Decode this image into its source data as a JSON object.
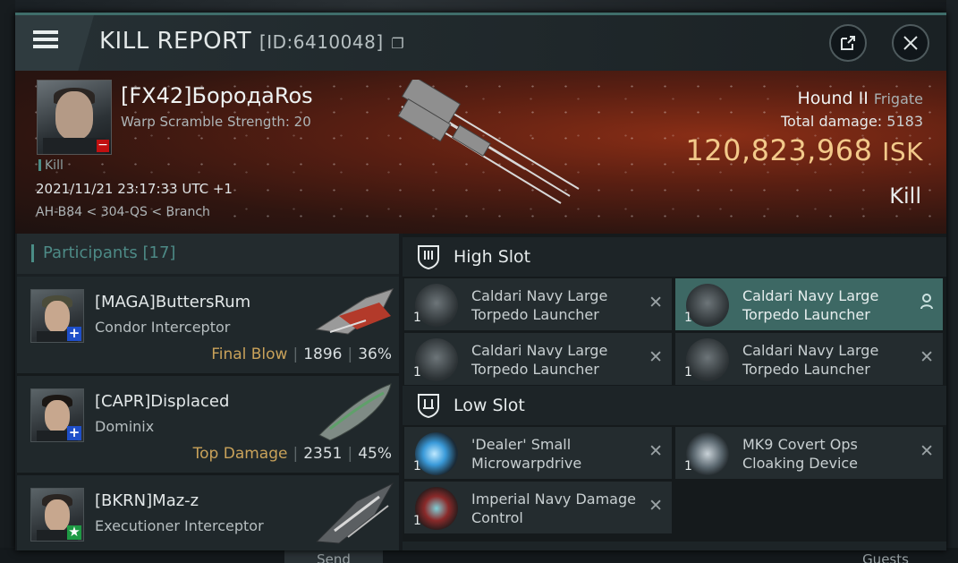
{
  "background": {
    "send_label": "Send",
    "guests_label": "Guests"
  },
  "window": {
    "title": "KILL REPORT",
    "id_label": "[ID:6410048]",
    "accent": "#3f6d6a"
  },
  "victim": {
    "name": "[FX42]БородаRos",
    "warp_scramble": "Warp Scramble Strength: 20",
    "kill_tag": "Kill",
    "datetime": "2021/11/21 23:17:33 UTC +1",
    "location": "AH-B84 < 304-QS < Branch",
    "ship_name": "Hound II",
    "ship_class": "Frigate",
    "total_damage_label": "Total damage:",
    "total_damage": "5183",
    "isk_value": "120,823,968",
    "isk_unit": "ISK",
    "result": "Kill"
  },
  "participants": {
    "label": "Participants",
    "count": "[17]",
    "rows": [
      {
        "name": "[MAGA]ButtersRum",
        "ship": "Condor Interceptor",
        "tag": "Final Blow",
        "damage": "1896",
        "percent": "36%",
        "badge_color": "#1f4fc9"
      },
      {
        "name": "[CAPR]Displaced",
        "ship": "Dominix",
        "tag": "Top Damage",
        "damage": "2351",
        "percent": "45%",
        "badge_color": "#1f4fc9"
      },
      {
        "name": "[BKRN]Maz-z",
        "ship": "Executioner Interceptor",
        "tag": "",
        "damage": "",
        "percent": "",
        "badge_color": "#1e9a44"
      }
    ]
  },
  "slots": {
    "high_label": "High Slot",
    "low_label": "Low Slot",
    "high": [
      {
        "name": "Caldari Navy Large Torpedo Launcher",
        "qty": "1"
      },
      {
        "name": "Caldari Navy Large Torpedo Launcher",
        "qty": "1"
      },
      {
        "name": "Caldari Navy Large Torpedo Launcher",
        "qty": "1"
      },
      {
        "name": "Caldari Navy Large Torpedo Launcher",
        "qty": "1"
      }
    ],
    "low": [
      {
        "name": "'Dealer' Small Microwarpdrive",
        "qty": "1"
      },
      {
        "name": "MK9 Covert Ops Cloaking Device",
        "qty": "1"
      },
      {
        "name": "Imperial Navy Damage Control",
        "qty": "1"
      }
    ]
  }
}
